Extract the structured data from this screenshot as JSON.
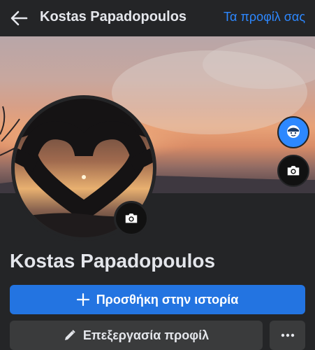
{
  "header": {
    "back_icon": "arrow-left-icon",
    "title": "Kostas Papadopoulos",
    "link_label": "Τα προφίλ σας"
  },
  "cover": {
    "avatar_button_icon": "avatar-icon",
    "camera_button_icon": "camera-icon"
  },
  "profile": {
    "camera_button_icon": "camera-icon",
    "name": "Kostas Papadopoulos"
  },
  "actions": {
    "add_story_label": "Προσθήκη στην ιστορία",
    "add_story_icon": "plus-icon",
    "edit_profile_label": "Επεξεργασία προφίλ",
    "edit_profile_icon": "pencil-icon",
    "more_icon": "more-horizontal-icon"
  },
  "colors": {
    "background": "#242527",
    "accent": "#2374e1",
    "link": "#2d88ff",
    "secondary_button": "#3a3b3c"
  }
}
